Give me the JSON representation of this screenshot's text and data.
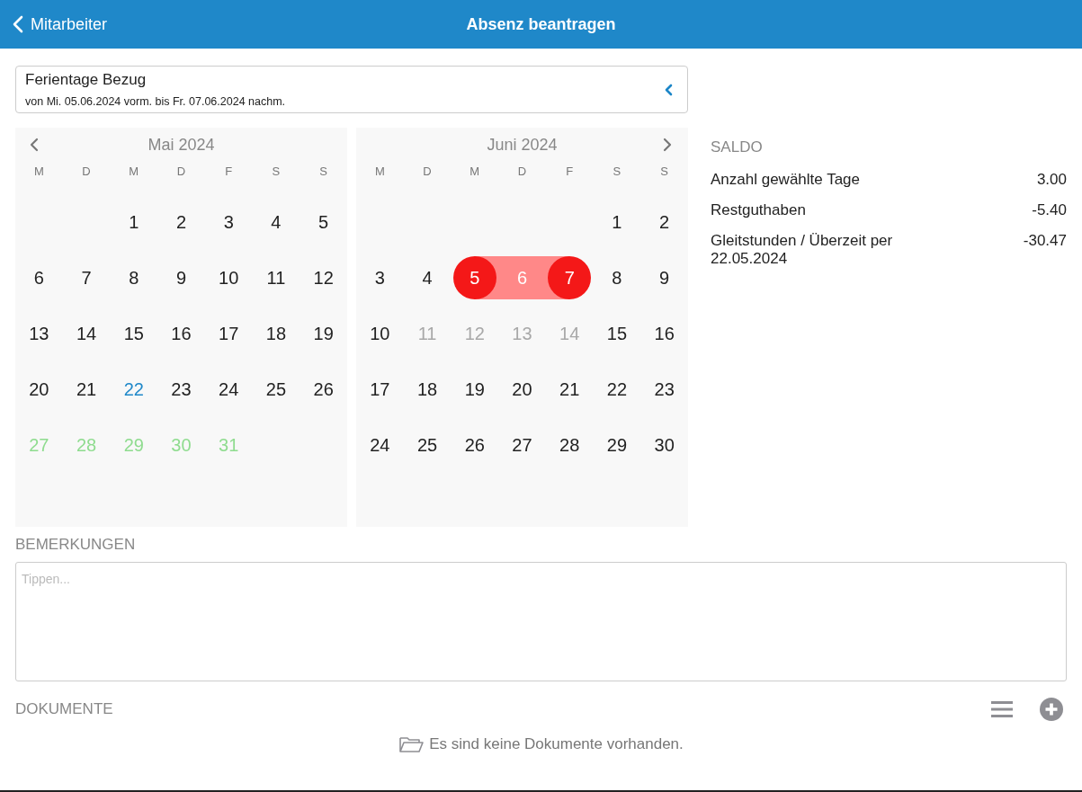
{
  "header": {
    "back_label": "Mitarbeiter",
    "title": "Absenz beantragen"
  },
  "absence": {
    "type": "Ferientage Bezug",
    "period": "von Mi. 05.06.2024 vorm. bis Fr. 07.06.2024 nachm."
  },
  "calendars": [
    {
      "title": "Mai 2024",
      "has_prev": true,
      "has_next": false,
      "weekdays": [
        "M",
        "D",
        "M",
        "D",
        "F",
        "S",
        "S"
      ],
      "days": [
        {
          "kind": "blank"
        },
        {
          "kind": "blank"
        },
        {
          "day": "1",
          "kind": "normal"
        },
        {
          "day": "2",
          "kind": "normal"
        },
        {
          "day": "3",
          "kind": "normal"
        },
        {
          "day": "4",
          "kind": "normal"
        },
        {
          "day": "5",
          "kind": "normal"
        },
        {
          "day": "6",
          "kind": "normal"
        },
        {
          "day": "7",
          "kind": "normal"
        },
        {
          "day": "8",
          "kind": "normal"
        },
        {
          "day": "9",
          "kind": "normal"
        },
        {
          "day": "10",
          "kind": "normal"
        },
        {
          "day": "11",
          "kind": "normal"
        },
        {
          "day": "12",
          "kind": "normal"
        },
        {
          "day": "13",
          "kind": "normal"
        },
        {
          "day": "14",
          "kind": "normal"
        },
        {
          "day": "15",
          "kind": "normal"
        },
        {
          "day": "16",
          "kind": "normal"
        },
        {
          "day": "17",
          "kind": "normal"
        },
        {
          "day": "18",
          "kind": "normal"
        },
        {
          "day": "19",
          "kind": "normal"
        },
        {
          "day": "20",
          "kind": "normal"
        },
        {
          "day": "21",
          "kind": "normal"
        },
        {
          "day": "22",
          "kind": "today"
        },
        {
          "day": "23",
          "kind": "normal"
        },
        {
          "day": "24",
          "kind": "normal"
        },
        {
          "day": "25",
          "kind": "normal"
        },
        {
          "day": "26",
          "kind": "normal"
        },
        {
          "day": "27",
          "kind": "green"
        },
        {
          "day": "28",
          "kind": "green"
        },
        {
          "day": "29",
          "kind": "green"
        },
        {
          "day": "30",
          "kind": "green"
        },
        {
          "day": "31",
          "kind": "green"
        }
      ]
    },
    {
      "title": "Juni 2024",
      "has_prev": false,
      "has_next": true,
      "weekdays": [
        "M",
        "D",
        "M",
        "D",
        "F",
        "S",
        "S"
      ],
      "days": [
        {
          "kind": "blank"
        },
        {
          "kind": "blank"
        },
        {
          "kind": "blank"
        },
        {
          "kind": "blank"
        },
        {
          "kind": "blank"
        },
        {
          "day": "1",
          "kind": "normal"
        },
        {
          "day": "2",
          "kind": "normal"
        },
        {
          "day": "3",
          "kind": "normal"
        },
        {
          "day": "4",
          "kind": "normal"
        },
        {
          "day": "5",
          "kind": "start"
        },
        {
          "day": "6",
          "kind": "mid"
        },
        {
          "day": "7",
          "kind": "end"
        },
        {
          "day": "8",
          "kind": "normal"
        },
        {
          "day": "9",
          "kind": "normal"
        },
        {
          "day": "10",
          "kind": "normal"
        },
        {
          "day": "11",
          "kind": "disabled"
        },
        {
          "day": "12",
          "kind": "disabled"
        },
        {
          "day": "13",
          "kind": "disabled"
        },
        {
          "day": "14",
          "kind": "disabled"
        },
        {
          "day": "15",
          "kind": "normal"
        },
        {
          "day": "16",
          "kind": "normal"
        },
        {
          "day": "17",
          "kind": "normal"
        },
        {
          "day": "18",
          "kind": "normal"
        },
        {
          "day": "19",
          "kind": "normal"
        },
        {
          "day": "20",
          "kind": "normal"
        },
        {
          "day": "21",
          "kind": "normal"
        },
        {
          "day": "22",
          "kind": "normal"
        },
        {
          "day": "23",
          "kind": "normal"
        },
        {
          "day": "24",
          "kind": "normal"
        },
        {
          "day": "25",
          "kind": "normal"
        },
        {
          "day": "26",
          "kind": "normal"
        },
        {
          "day": "27",
          "kind": "normal"
        },
        {
          "day": "28",
          "kind": "normal"
        },
        {
          "day": "29",
          "kind": "normal"
        },
        {
          "day": "30",
          "kind": "normal"
        }
      ]
    }
  ],
  "saldo": {
    "title": "SALDO",
    "rows": [
      {
        "label": "Anzahl gewählte Tage",
        "value": "3.00"
      },
      {
        "label": "Restguthaben",
        "value": "-5.40"
      },
      {
        "label": "Gleitstunden / Überzeit per 22.05.2024",
        "value": "-30.47"
      }
    ]
  },
  "remarks": {
    "title": "BEMERKUNGEN",
    "placeholder": "Tippen..."
  },
  "documents": {
    "title": "DOKUMENTE",
    "empty_text": "Es sind keine Dokumente vorhanden."
  }
}
